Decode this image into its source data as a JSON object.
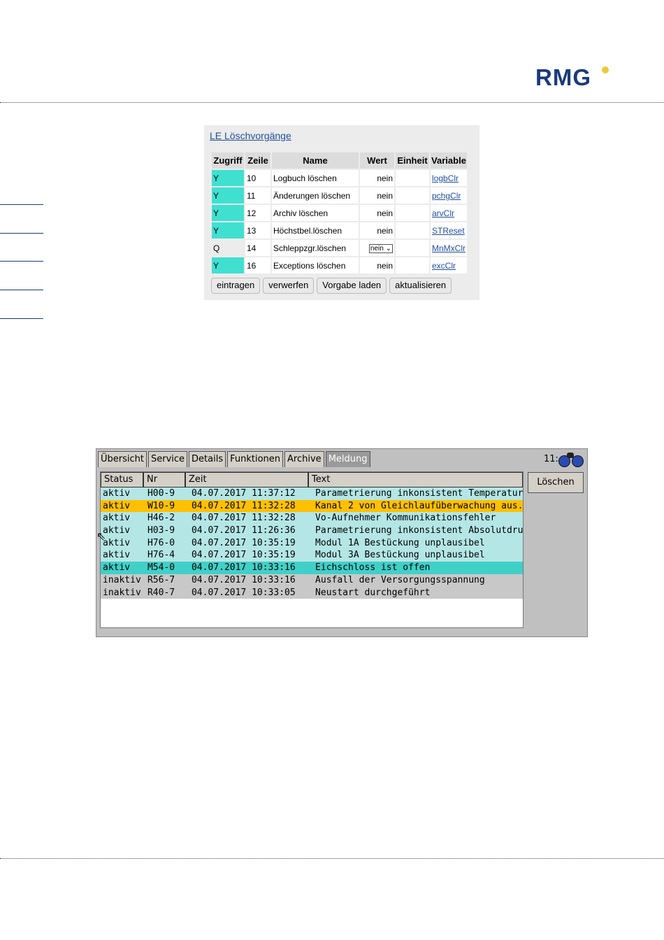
{
  "brand": {
    "logo_text": "RMG",
    "logo_color": "#1a3a7c",
    "dot_color": "#f0c93a"
  },
  "web_panel": {
    "title": "LE Löschvorgänge",
    "columns": [
      "Zugriff",
      "Zeile",
      "Name",
      "Wert",
      "Einheit",
      "Variable"
    ],
    "rows": [
      {
        "access": "Y",
        "line": "10",
        "name": "Logbuch löschen",
        "value": "nein",
        "unit": "",
        "variable": "logbClr"
      },
      {
        "access": "Y",
        "line": "11",
        "name": "Änderungen löschen",
        "value": "nein",
        "unit": "",
        "variable": "pchgClr"
      },
      {
        "access": "Y",
        "line": "12",
        "name": "Archiv löschen",
        "value": "nein",
        "unit": "",
        "variable": "arvClr"
      },
      {
        "access": "Y",
        "line": "13",
        "name": "Höchstbel.löschen",
        "value": "nein",
        "unit": "",
        "variable": "STReset"
      },
      {
        "access": "Q",
        "line": "14",
        "name": "Schleppzgr.löschen",
        "value": "nein",
        "unit": "",
        "variable": "MnMxClr"
      },
      {
        "access": "Y",
        "line": "16",
        "name": "Exceptions löschen",
        "value": "nein",
        "unit": "",
        "variable": "excClr"
      }
    ],
    "buttons": {
      "enter": "eintragen",
      "discard": "verwerfen",
      "load_default": "Vorgabe laden",
      "refresh": "aktualisieren"
    },
    "access_color": "#40e0d0"
  },
  "device": {
    "tabs": [
      "Übersicht",
      "Service",
      "Details",
      "Funktionen",
      "Archive",
      "Meldung"
    ],
    "active_tab": "Meldung",
    "clock": "11:",
    "columns": [
      "Status",
      "Nr",
      "Zeit",
      "Text"
    ],
    "rows": [
      {
        "status": "aktiv",
        "nr": "H00-9",
        "time": "04.07.2017 11:37:12",
        "text": "Parametrierung inkonsistent Temperatur",
        "color": "#b4e6e6"
      },
      {
        "status": "aktiv",
        "nr": "W10-9",
        "time": "04.07.2017 11:32:28",
        "text": "Kanal 2 von Gleichlaufüberwachung aus...",
        "color": "#ffc000"
      },
      {
        "status": "aktiv",
        "nr": "H46-2",
        "time": "04.07.2017 11:32:28",
        "text": "Vo-Aufnehmer Kommunikationsfehler",
        "color": "#b4e6e6"
      },
      {
        "status": "aktiv",
        "nr": "H03-9",
        "time": "04.07.2017 11:26:36",
        "text": "Parametrierung inkonsistent Absolutdruck",
        "color": "#b4e6e6"
      },
      {
        "status": "aktiv",
        "nr": "H76-0",
        "time": "04.07.2017 10:35:19",
        "text": "Modul 1A Bestückung unplausibel",
        "color": "#b4e6e6"
      },
      {
        "status": "aktiv",
        "nr": "H76-4",
        "time": "04.07.2017 10:35:19",
        "text": "Modul 3A Bestückung unplausibel",
        "color": "#b4e6e6"
      },
      {
        "status": "aktiv",
        "nr": "M54-0",
        "time": "04.07.2017 10:33:16",
        "text": "Eichschloss ist offen",
        "color": "#40d0c8"
      },
      {
        "status": "inaktiv",
        "nr": "R56-7",
        "time": "04.07.2017 10:33:16",
        "text": "Ausfall der Versorgungsspannung",
        "color": "#c8c8c8"
      },
      {
        "status": "inaktiv",
        "nr": "R40-7",
        "time": "04.07.2017 10:33:05",
        "text": "Neustart durchgeführt",
        "color": "#c8c8c8"
      }
    ],
    "delete_button": "Löschen"
  }
}
